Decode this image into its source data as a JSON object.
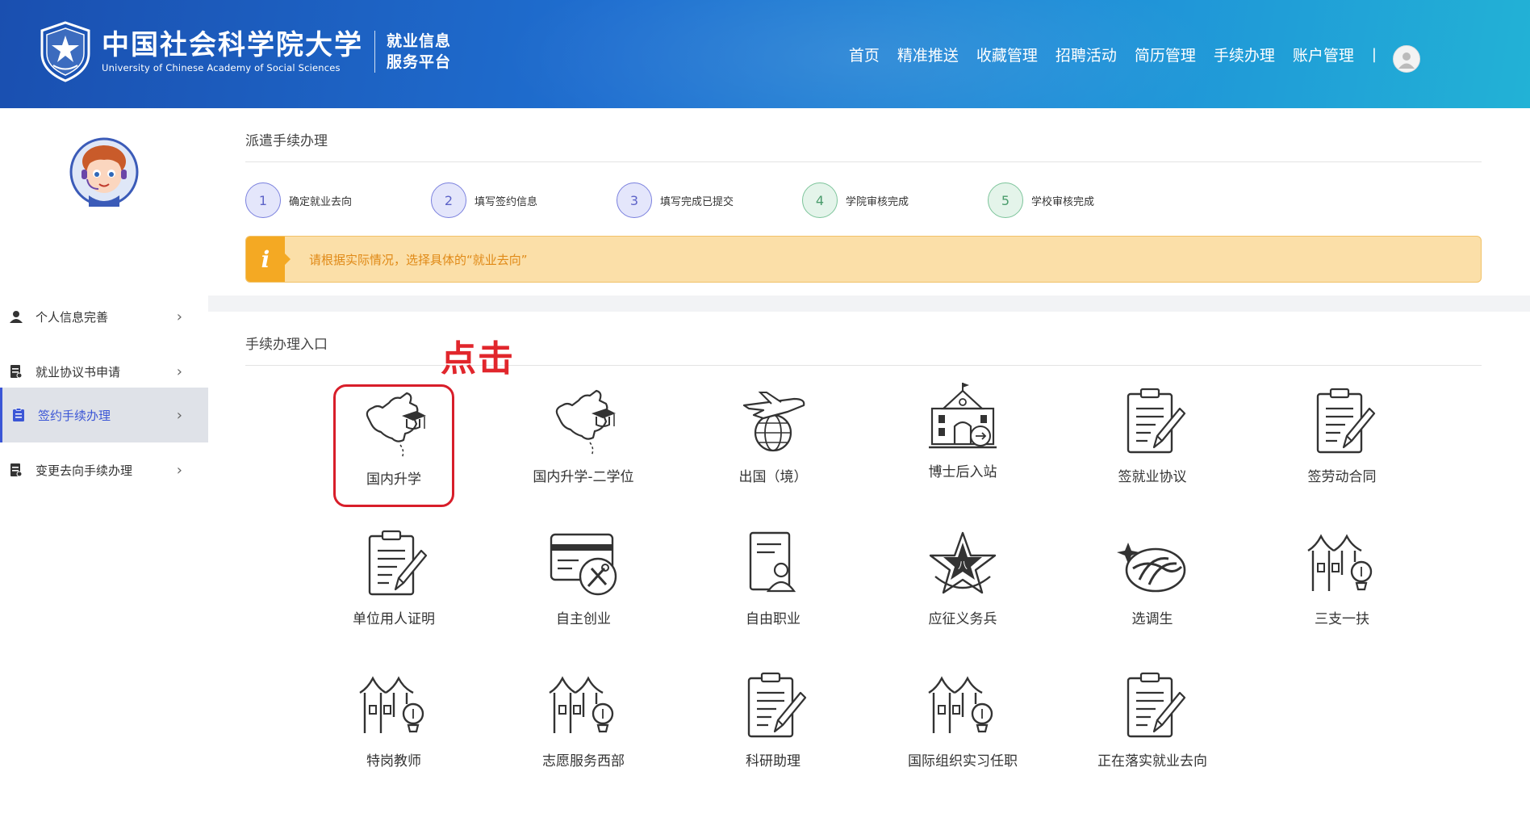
{
  "header": {
    "school_cn": "中国社会科学院大学",
    "school_en": "University of Chinese Academy of Social Sciences",
    "platform_line1": "就业信息",
    "platform_line2": "服务平台",
    "nav": [
      "首页",
      "精准推送",
      "收藏管理",
      "招聘活动",
      "简历管理",
      "手续办理",
      "账户管理"
    ],
    "nav_separator": "|"
  },
  "sidebar": {
    "items": [
      {
        "label": "个人信息完善",
        "icon": "user-icon",
        "active": false
      },
      {
        "label": "就业协议书申请",
        "icon": "document-icon",
        "active": false
      },
      {
        "label": "签约手续办理",
        "icon": "clipboard-icon",
        "active": true
      },
      {
        "label": "变更去向手续办理",
        "icon": "document-icon",
        "active": false
      }
    ],
    "arrow": "›"
  },
  "dispatch": {
    "title": "派遣手续办理",
    "steps": [
      {
        "num": "1",
        "label": "确定就业去向",
        "state": "blue"
      },
      {
        "num": "2",
        "label": "填写签约信息",
        "state": "blue"
      },
      {
        "num": "3",
        "label": "填写完成已提交",
        "state": "blue"
      },
      {
        "num": "4",
        "label": "学院审核完成",
        "state": "green"
      },
      {
        "num": "5",
        "label": "学校审核完成",
        "state": "green"
      }
    ],
    "notice_icon": "i",
    "notice": "请根据实际情况，选择具体的“就业去向”"
  },
  "entry": {
    "title": "手续办理入口",
    "click_tip": "点击",
    "tiles": [
      {
        "label": "国内升学",
        "icon": "china-map-graduation-icon"
      },
      {
        "label": "国内升学-二学位",
        "icon": "china-map-graduation-icon"
      },
      {
        "label": "出国（境）",
        "icon": "airplane-globe-icon"
      },
      {
        "label": "博士后入站",
        "icon": "institute-building-icon"
      },
      {
        "label": "签就业协议",
        "icon": "document-pen-icon"
      },
      {
        "label": "签劳动合同",
        "icon": "document-pen-icon"
      },
      {
        "label": "单位用人证明",
        "icon": "document-pen-icon"
      },
      {
        "label": "自主创业",
        "icon": "card-tools-icon"
      },
      {
        "label": "自由职业",
        "icon": "id-card-person-icon"
      },
      {
        "label": "应征义务兵",
        "icon": "army-star-emblem-icon"
      },
      {
        "label": "选调生",
        "icon": "selection-emblem-icon"
      },
      {
        "label": "三支一扶",
        "icon": "village-bulb-icon"
      },
      {
        "label": "特岗教师",
        "icon": "village-bulb-icon"
      },
      {
        "label": "志愿服务西部",
        "icon": "village-bulb-icon"
      },
      {
        "label": "科研助理",
        "icon": "document-pen-icon"
      },
      {
        "label": "国际组织实习任职",
        "icon": "village-bulb-icon"
      },
      {
        "label": "正在落实就业去向",
        "icon": "document-pen-icon"
      }
    ]
  },
  "colors": {
    "accent": "#3b56d6",
    "highlight": "#d81e2a",
    "notice_bg": "#fbdfa8",
    "notice_text": "#e08a17"
  }
}
